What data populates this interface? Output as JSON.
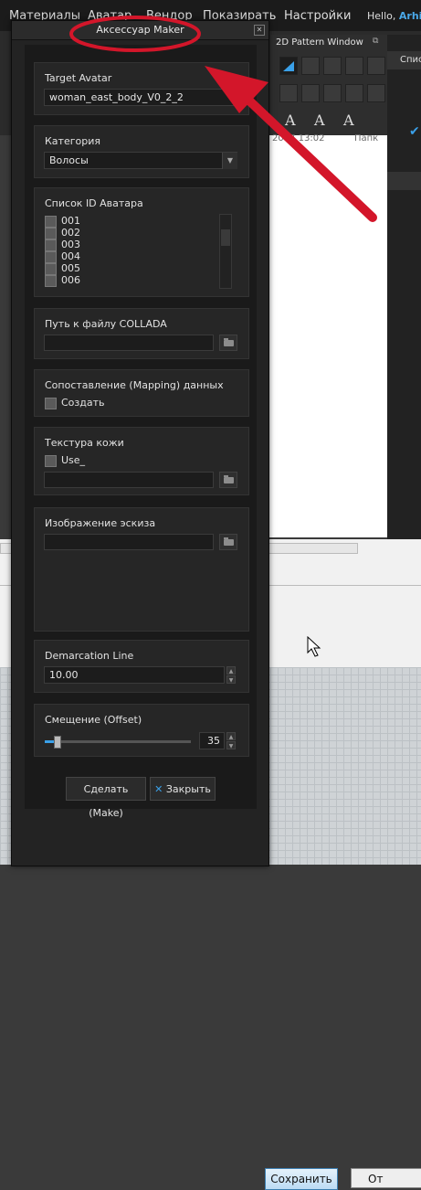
{
  "menubar": {
    "items": [
      "Материалы",
      "Аватар",
      "Вендор",
      "Показирать",
      "Настройки"
    ],
    "hello_prefix": "Hello, ",
    "hello_user": "Arhin"
  },
  "pattern_window": {
    "title": "2D Pattern Window"
  },
  "background": {
    "date_text": "2017 13:02",
    "col_text": "Папк",
    "right_col_text": "Списо",
    "save_label": "Сохранить",
    "cancel_label": "От"
  },
  "dialog": {
    "title": "Аксессуар Maker",
    "target_avatar": {
      "label": "Target Avatar",
      "value": "woman_east_body_V0_2_2"
    },
    "category": {
      "label": "Категория",
      "value": "Волосы"
    },
    "avatar_ids": {
      "label": "Список ID Аватара",
      "items": [
        "001",
        "002",
        "003",
        "004",
        "005",
        "006"
      ]
    },
    "collada": {
      "label": "Путь к файлу COLLADA",
      "value": ""
    },
    "mapping": {
      "label": "Сопоставление (Mapping) данных",
      "checkbox_label": "Создать"
    },
    "skin_texture": {
      "label": "Текстура кожи",
      "checkbox_label": "Use_",
      "value": ""
    },
    "sketch": {
      "label": "Изображение эскиза",
      "value": ""
    },
    "demarcation": {
      "label": "Demarcation Line",
      "value": "10.00"
    },
    "offset": {
      "label": "Смещение (Offset)",
      "value": "35",
      "slider_fraction": 0.08
    },
    "make_label": "Сделать (Make)",
    "close_label": "Закрыть"
  },
  "colors": {
    "accent": "#3aa0e8",
    "annotation": "#d3162a"
  }
}
